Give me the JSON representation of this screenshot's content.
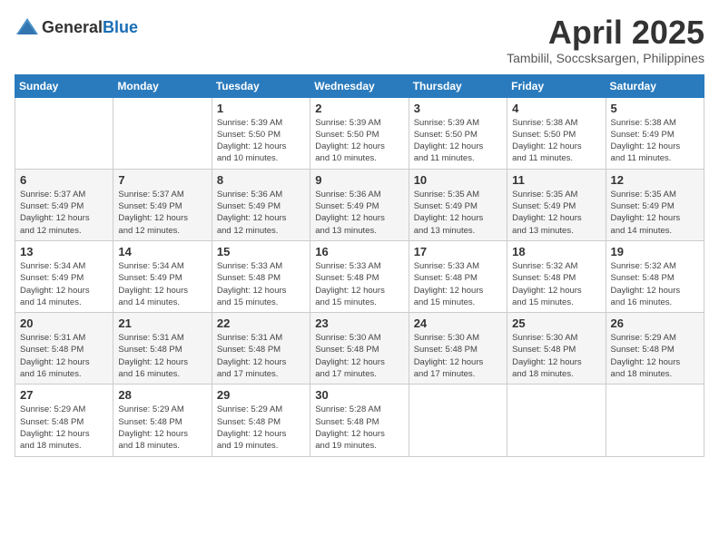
{
  "logo": {
    "text_general": "General",
    "text_blue": "Blue"
  },
  "title": {
    "month_year": "April 2025",
    "location": "Tambilil, Soccsksargen, Philippines"
  },
  "weekdays": [
    "Sunday",
    "Monday",
    "Tuesday",
    "Wednesday",
    "Thursday",
    "Friday",
    "Saturday"
  ],
  "weeks": [
    [
      {
        "day": "",
        "detail": ""
      },
      {
        "day": "",
        "detail": ""
      },
      {
        "day": "1",
        "detail": "Sunrise: 5:39 AM\nSunset: 5:50 PM\nDaylight: 12 hours\nand 10 minutes."
      },
      {
        "day": "2",
        "detail": "Sunrise: 5:39 AM\nSunset: 5:50 PM\nDaylight: 12 hours\nand 10 minutes."
      },
      {
        "day": "3",
        "detail": "Sunrise: 5:39 AM\nSunset: 5:50 PM\nDaylight: 12 hours\nand 11 minutes."
      },
      {
        "day": "4",
        "detail": "Sunrise: 5:38 AM\nSunset: 5:50 PM\nDaylight: 12 hours\nand 11 minutes."
      },
      {
        "day": "5",
        "detail": "Sunrise: 5:38 AM\nSunset: 5:49 PM\nDaylight: 12 hours\nand 11 minutes."
      }
    ],
    [
      {
        "day": "6",
        "detail": "Sunrise: 5:37 AM\nSunset: 5:49 PM\nDaylight: 12 hours\nand 12 minutes."
      },
      {
        "day": "7",
        "detail": "Sunrise: 5:37 AM\nSunset: 5:49 PM\nDaylight: 12 hours\nand 12 minutes."
      },
      {
        "day": "8",
        "detail": "Sunrise: 5:36 AM\nSunset: 5:49 PM\nDaylight: 12 hours\nand 12 minutes."
      },
      {
        "day": "9",
        "detail": "Sunrise: 5:36 AM\nSunset: 5:49 PM\nDaylight: 12 hours\nand 13 minutes."
      },
      {
        "day": "10",
        "detail": "Sunrise: 5:35 AM\nSunset: 5:49 PM\nDaylight: 12 hours\nand 13 minutes."
      },
      {
        "day": "11",
        "detail": "Sunrise: 5:35 AM\nSunset: 5:49 PM\nDaylight: 12 hours\nand 13 minutes."
      },
      {
        "day": "12",
        "detail": "Sunrise: 5:35 AM\nSunset: 5:49 PM\nDaylight: 12 hours\nand 14 minutes."
      }
    ],
    [
      {
        "day": "13",
        "detail": "Sunrise: 5:34 AM\nSunset: 5:49 PM\nDaylight: 12 hours\nand 14 minutes."
      },
      {
        "day": "14",
        "detail": "Sunrise: 5:34 AM\nSunset: 5:49 PM\nDaylight: 12 hours\nand 14 minutes."
      },
      {
        "day": "15",
        "detail": "Sunrise: 5:33 AM\nSunset: 5:48 PM\nDaylight: 12 hours\nand 15 minutes."
      },
      {
        "day": "16",
        "detail": "Sunrise: 5:33 AM\nSunset: 5:48 PM\nDaylight: 12 hours\nand 15 minutes."
      },
      {
        "day": "17",
        "detail": "Sunrise: 5:33 AM\nSunset: 5:48 PM\nDaylight: 12 hours\nand 15 minutes."
      },
      {
        "day": "18",
        "detail": "Sunrise: 5:32 AM\nSunset: 5:48 PM\nDaylight: 12 hours\nand 15 minutes."
      },
      {
        "day": "19",
        "detail": "Sunrise: 5:32 AM\nSunset: 5:48 PM\nDaylight: 12 hours\nand 16 minutes."
      }
    ],
    [
      {
        "day": "20",
        "detail": "Sunrise: 5:31 AM\nSunset: 5:48 PM\nDaylight: 12 hours\nand 16 minutes."
      },
      {
        "day": "21",
        "detail": "Sunrise: 5:31 AM\nSunset: 5:48 PM\nDaylight: 12 hours\nand 16 minutes."
      },
      {
        "day": "22",
        "detail": "Sunrise: 5:31 AM\nSunset: 5:48 PM\nDaylight: 12 hours\nand 17 minutes."
      },
      {
        "day": "23",
        "detail": "Sunrise: 5:30 AM\nSunset: 5:48 PM\nDaylight: 12 hours\nand 17 minutes."
      },
      {
        "day": "24",
        "detail": "Sunrise: 5:30 AM\nSunset: 5:48 PM\nDaylight: 12 hours\nand 17 minutes."
      },
      {
        "day": "25",
        "detail": "Sunrise: 5:30 AM\nSunset: 5:48 PM\nDaylight: 12 hours\nand 18 minutes."
      },
      {
        "day": "26",
        "detail": "Sunrise: 5:29 AM\nSunset: 5:48 PM\nDaylight: 12 hours\nand 18 minutes."
      }
    ],
    [
      {
        "day": "27",
        "detail": "Sunrise: 5:29 AM\nSunset: 5:48 PM\nDaylight: 12 hours\nand 18 minutes."
      },
      {
        "day": "28",
        "detail": "Sunrise: 5:29 AM\nSunset: 5:48 PM\nDaylight: 12 hours\nand 18 minutes."
      },
      {
        "day": "29",
        "detail": "Sunrise: 5:29 AM\nSunset: 5:48 PM\nDaylight: 12 hours\nand 19 minutes."
      },
      {
        "day": "30",
        "detail": "Sunrise: 5:28 AM\nSunset: 5:48 PM\nDaylight: 12 hours\nand 19 minutes."
      },
      {
        "day": "",
        "detail": ""
      },
      {
        "day": "",
        "detail": ""
      },
      {
        "day": "",
        "detail": ""
      }
    ]
  ]
}
